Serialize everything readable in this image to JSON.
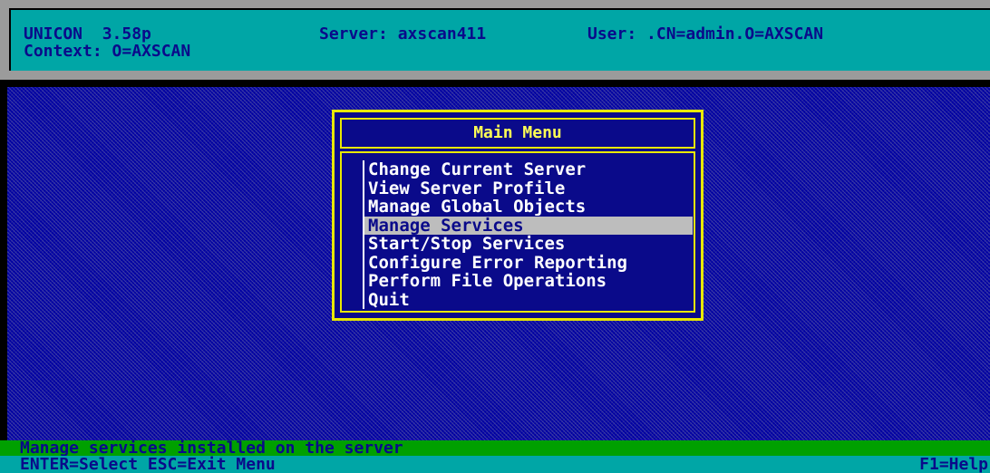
{
  "header": {
    "app": "UNICON  3.58p",
    "context": "Context: O=AXSCAN",
    "server": "Server: axscan411",
    "user": "User: .CN=admin.O=AXSCAN"
  },
  "menu": {
    "title": "Main Menu",
    "items": [
      {
        "label": "Change Current Server",
        "selected": false
      },
      {
        "label": "View Server Profile",
        "selected": false
      },
      {
        "label": "Manage Global Objects",
        "selected": false
      },
      {
        "label": "Manage Services",
        "selected": true
      },
      {
        "label": "Start/Stop Services",
        "selected": false
      },
      {
        "label": "Configure Error Reporting",
        "selected": false
      },
      {
        "label": "Perform File Operations",
        "selected": false
      },
      {
        "label": "Quit",
        "selected": false
      }
    ]
  },
  "status": {
    "message": "Manage services installed on the server"
  },
  "keys": {
    "left": "ENTER=Select ESC=Exit Menu",
    "right": "F1=Help"
  },
  "colors": {
    "desktop": "#0000a4",
    "header": "#00a6a6",
    "menu_border": "#e8e800",
    "menu_title": "#ffff55",
    "selection": "#bdbdbd",
    "status_bar": "#00a000"
  }
}
